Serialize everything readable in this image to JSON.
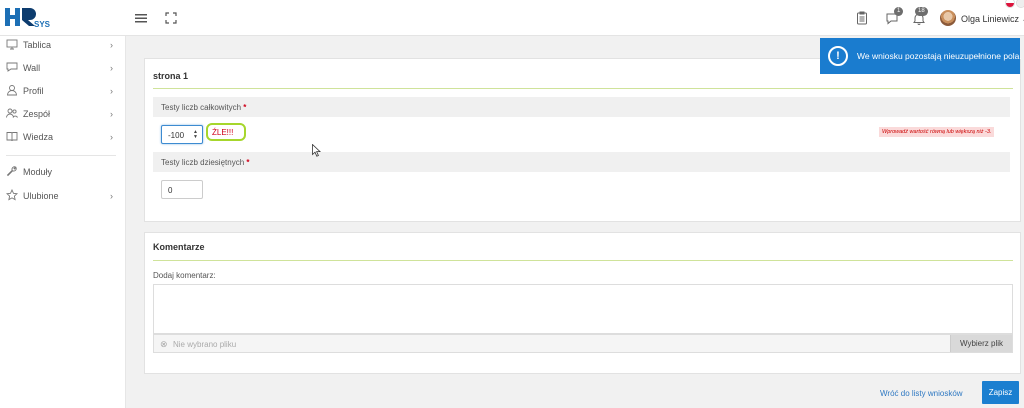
{
  "header": {
    "logo_text": "HRsys",
    "notif_messages_count": "1",
    "notif_bell_count": "18",
    "user_name": "Olga Liniewicz"
  },
  "sidebar": {
    "items": [
      {
        "label": "Tablica",
        "icon": "monitor-icon",
        "has_children": true
      },
      {
        "label": "Wall",
        "icon": "chat-bubble-icon",
        "has_children": true
      },
      {
        "label": "Profil",
        "icon": "user-icon",
        "has_children": true
      },
      {
        "label": "Zespół",
        "icon": "team-icon",
        "has_children": true
      },
      {
        "label": "Wiedza",
        "icon": "book-icon",
        "has_children": true
      },
      {
        "label": "Moduły",
        "icon": "wrench-icon",
        "has_children": false
      },
      {
        "label": "Ulubione",
        "icon": "star-icon",
        "has_children": true
      }
    ],
    "chevron": "›"
  },
  "form": {
    "section_title": "strona 1",
    "field1": {
      "label": "Testy liczb całkowitych",
      "required_mark": "*",
      "value": "-100",
      "status_text": "ŹLE!!!",
      "error_hint": "Wprowadź wartość równą lub większą niż -3."
    },
    "field2": {
      "label": "Testy liczb dziesiętnych",
      "required_mark": "*",
      "value": "0"
    }
  },
  "comments": {
    "title": "Komentarze",
    "add_label": "Dodaj komentarz:",
    "no_file_text": "Nie wybrano pliku",
    "choose_file_label": "Wybierz plik"
  },
  "footer": {
    "back_link": "Wróć do listy wniosków",
    "save_label": "Zapisz"
  },
  "toast": {
    "icon": "!",
    "message": "We wniosku pozostają nieuzupełnione pola."
  },
  "colors": {
    "brand_blue": "#1a7ccf",
    "accent_green": "#a6d62c",
    "error_red": "#d0021b"
  }
}
